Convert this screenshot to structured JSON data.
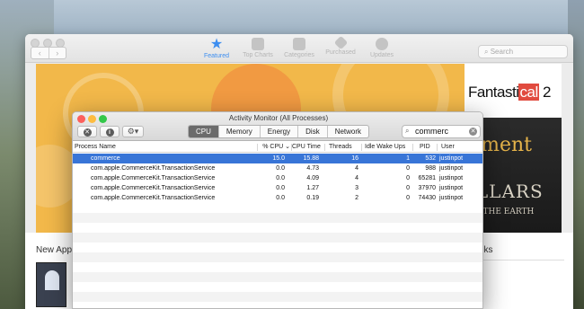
{
  "store": {
    "toolbar": {
      "nav_back": "‹",
      "nav_forward": "›",
      "items": [
        {
          "label": "Featured",
          "icon": "star-icon",
          "active": true
        },
        {
          "label": "Top Charts",
          "icon": "list-icon",
          "active": false
        },
        {
          "label": "Categories",
          "icon": "box-icon",
          "active": false
        },
        {
          "label": "Purchased",
          "icon": "tag-icon",
          "active": false
        },
        {
          "label": "Updates",
          "icon": "download-icon",
          "active": false
        }
      ],
      "search_placeholder": "Search"
    },
    "banner": {
      "fantastical_pre": "Fantasti",
      "fantastical_cal": "cal",
      "fantastical_post": " 2",
      "fragment_text": "gment",
      "pillars_text": "ILLARS",
      "earth_text": "OF THE EARTH"
    },
    "sections": {
      "new_apps": "New Apps",
      "links": "nks"
    }
  },
  "activity_monitor": {
    "title": "Activity Monitor (All Processes)",
    "tabs": [
      "CPU",
      "Memory",
      "Energy",
      "Disk",
      "Network"
    ],
    "active_tab": "CPU",
    "search_value": "commerc",
    "columns": {
      "name": "Process Name",
      "cpu": "% CPU",
      "cpu_time": "CPU Time",
      "threads": "Threads",
      "idle_wake": "Idle Wake Ups",
      "pid": "PID",
      "user": "User"
    },
    "rows": [
      {
        "name": "commerce",
        "cpu": "15.0",
        "cpu_time": "15.88",
        "threads": "16",
        "idle": "1",
        "pid": "532",
        "user": "justinpot",
        "selected": true
      },
      {
        "name": "com.apple.CommerceKit.TransactionService",
        "cpu": "0.0",
        "cpu_time": "4.73",
        "threads": "4",
        "idle": "0",
        "pid": "988",
        "user": "justinpot",
        "selected": false
      },
      {
        "name": "com.apple.CommerceKit.TransactionService",
        "cpu": "0.0",
        "cpu_time": "4.09",
        "threads": "4",
        "idle": "0",
        "pid": "65281",
        "user": "justinpot",
        "selected": false
      },
      {
        "name": "com.apple.CommerceKit.TransactionService",
        "cpu": "0.0",
        "cpu_time": "1.27",
        "threads": "3",
        "idle": "0",
        "pid": "37970",
        "user": "justinpot",
        "selected": false
      },
      {
        "name": "com.apple.CommerceKit.TransactionService",
        "cpu": "0.0",
        "cpu_time": "0.19",
        "threads": "2",
        "idle": "0",
        "pid": "74430",
        "user": "justinpot",
        "selected": false
      }
    ],
    "colors": {
      "selected_row": "#3875d7",
      "close": "#fc605c",
      "minimize": "#fdbc40",
      "zoom": "#34c84a"
    }
  }
}
